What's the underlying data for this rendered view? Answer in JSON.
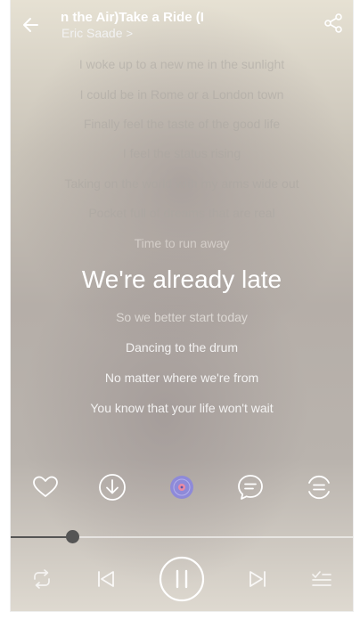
{
  "header": {
    "title": "n the Air)Take a Ride (I",
    "artist": "Eric Saade",
    "artist_chevron": ">"
  },
  "lyrics": {
    "lines": [
      "I woke up to a new me in the sunlight",
      "I could be in Rome or a London town",
      "Finally feel the taste of the good life",
      "I feel the status rising",
      "Taking on the world with my arms wide out",
      "Pocket full of dreams that are real",
      "Time to run away",
      "We're already late",
      "So we better start today",
      "Dancing to the drum",
      "No matter where we're from",
      "You know that your life won't wait"
    ],
    "current_index": 7
  },
  "actions": {
    "items": [
      "heart-icon",
      "download-icon",
      "vinyl-icon",
      "comment-icon",
      "more-icon"
    ],
    "vinyl_color": "#8e8ad9"
  },
  "progress": {
    "position_fraction": 0.18
  },
  "controls": {
    "items": [
      "repeat-icon",
      "previous-icon",
      "pause-icon",
      "next-icon",
      "playlist-icon"
    ]
  }
}
